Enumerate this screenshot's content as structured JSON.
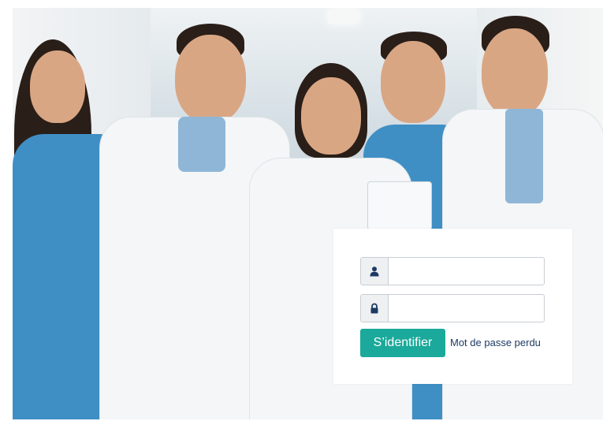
{
  "login": {
    "username_value": "",
    "username_placeholder": "",
    "password_value": "",
    "password_placeholder": "",
    "submit_label": "S’identifier",
    "forgot_label": "Mot de passe perdu"
  },
  "icons": {
    "username": "user-icon",
    "password": "lock-icon"
  },
  "colors": {
    "accent": "#1aa99a",
    "link": "#1d3a63",
    "icon": "#1d3a63"
  }
}
